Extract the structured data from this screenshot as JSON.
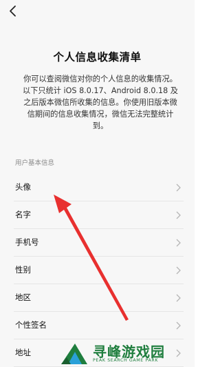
{
  "header": {
    "back_icon": "chevron-left-icon"
  },
  "page": {
    "title": "个人信息收集清单",
    "description": "你可以查阅微信对你的个人信息的收集情况。以下只统计 iOS 8.0.17、Android 8.0.18 及之后版本微信所收集的信息。你使用旧版本微信期间的信息收集情况，微信无法完整统计到。"
  },
  "section": {
    "label": "用户基本信息",
    "items": [
      {
        "label": "头像"
      },
      {
        "label": "名字"
      },
      {
        "label": "手机号"
      },
      {
        "label": "性别"
      },
      {
        "label": "地区"
      },
      {
        "label": "个性签名"
      },
      {
        "label": "地址"
      }
    ]
  },
  "annotation": {
    "color": "#e8302f"
  },
  "watermark": {
    "text": "寻峰游戏园",
    "subtext": "PEAK SEARCH GAME PARK",
    "color": "#1f7e3e"
  }
}
